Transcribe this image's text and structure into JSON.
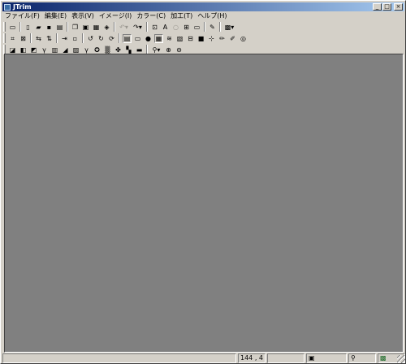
{
  "window": {
    "title": "JTrim",
    "controls": {
      "minimize": "_",
      "maximize": "□",
      "close": "×"
    }
  },
  "menu": [
    "ファイル(F)",
    "編集(E)",
    "表示(V)",
    "イメージ(I)",
    "カラー(C)",
    "加工(T)",
    "ヘルプ(H)"
  ],
  "toolbar1": [
    {
      "name": "new-window-icon",
      "glyph": "▭"
    },
    {
      "name": "new-file-icon",
      "glyph": "▯"
    },
    {
      "name": "open-folder-icon",
      "glyph": "▰"
    },
    {
      "name": "save-icon",
      "glyph": "▪"
    },
    {
      "name": "print-icon",
      "glyph": "▤"
    },
    {
      "name": "copy-icon",
      "glyph": "❐"
    },
    {
      "name": "paste-icon",
      "glyph": "▣"
    },
    {
      "name": "paste-new-icon",
      "glyph": "▦"
    },
    {
      "name": "capture-icon",
      "glyph": "◈"
    },
    {
      "name": "undo-icon",
      "glyph": "↶"
    },
    {
      "name": "redo-icon",
      "glyph": "↷"
    },
    {
      "name": "select-all-icon",
      "glyph": "⊡"
    },
    {
      "name": "text-icon",
      "glyph": "A"
    },
    {
      "name": "circle-select-icon",
      "glyph": "○"
    },
    {
      "name": "grid-icon",
      "glyph": "⊞"
    },
    {
      "name": "frame-icon",
      "glyph": "▭"
    },
    {
      "name": "eyedropper-icon",
      "glyph": "✎"
    },
    {
      "name": "color-palette-icon",
      "glyph": "▩"
    }
  ],
  "toolbar2": [
    {
      "name": "trim-icon",
      "glyph": "⌗"
    },
    {
      "name": "resize-icon",
      "glyph": "⊠"
    },
    {
      "name": "flip-horizontal-icon",
      "glyph": "⇆"
    },
    {
      "name": "flip-vertical-icon",
      "glyph": "⇅"
    },
    {
      "name": "shift-icon",
      "glyph": "⇥"
    },
    {
      "name": "fit-window-icon",
      "glyph": "▫"
    },
    {
      "name": "rotate-left-icon",
      "glyph": "↺"
    },
    {
      "name": "rotate-right-icon",
      "glyph": "↻"
    },
    {
      "name": "rotate-free-icon",
      "glyph": "⟳"
    },
    {
      "name": "layer-icon",
      "glyph": "▤"
    },
    {
      "name": "canvas-icon",
      "glyph": "▭"
    },
    {
      "name": "circle-fill-icon",
      "glyph": "●"
    },
    {
      "name": "mosaic-icon",
      "glyph": "▦"
    },
    {
      "name": "wave-icon",
      "glyph": "≋"
    },
    {
      "name": "halftone-icon",
      "glyph": "▧"
    },
    {
      "name": "border-icon",
      "glyph": "⊟"
    },
    {
      "name": "black-square-icon",
      "glyph": "■"
    },
    {
      "name": "dotted-frame-icon",
      "glyph": "⊹"
    },
    {
      "name": "pencil-icon",
      "glyph": "✏"
    },
    {
      "name": "brush-icon",
      "glyph": "✐"
    },
    {
      "name": "spiral-icon",
      "glyph": "◎"
    }
  ],
  "toolbar3": [
    {
      "name": "gradient-icon",
      "glyph": "◪"
    },
    {
      "name": "brightness-icon",
      "glyph": "◧"
    },
    {
      "name": "contrast-icon",
      "glyph": "◩"
    },
    {
      "name": "gamma-icon",
      "glyph": "γ"
    },
    {
      "name": "color-balance-icon",
      "glyph": "▥"
    },
    {
      "name": "tone-curve-icon",
      "glyph": "◢"
    },
    {
      "name": "image-icon",
      "glyph": "▨"
    },
    {
      "name": "gamma-correct-icon",
      "glyph": "γ"
    },
    {
      "name": "color-wheel-icon",
      "glyph": "✪"
    },
    {
      "name": "dither-icon",
      "glyph": "▒"
    },
    {
      "name": "rgb-icon",
      "glyph": "✤"
    },
    {
      "name": "noise-icon",
      "glyph": "▚"
    },
    {
      "name": "sharpen-icon",
      "glyph": "▬"
    },
    {
      "name": "zoom-dropdown-icon",
      "glyph": "⚲"
    },
    {
      "name": "zoom-in-icon",
      "glyph": "⊕"
    },
    {
      "name": "zoom-out-icon",
      "glyph": "⊖"
    }
  ],
  "status": {
    "message": "",
    "coords": "144 , 4",
    "size": ""
  },
  "colors": {
    "canvas": "#808080",
    "chrome": "#d4d0c8",
    "title_start": "#0a246a",
    "title_end": "#a6caf0"
  }
}
